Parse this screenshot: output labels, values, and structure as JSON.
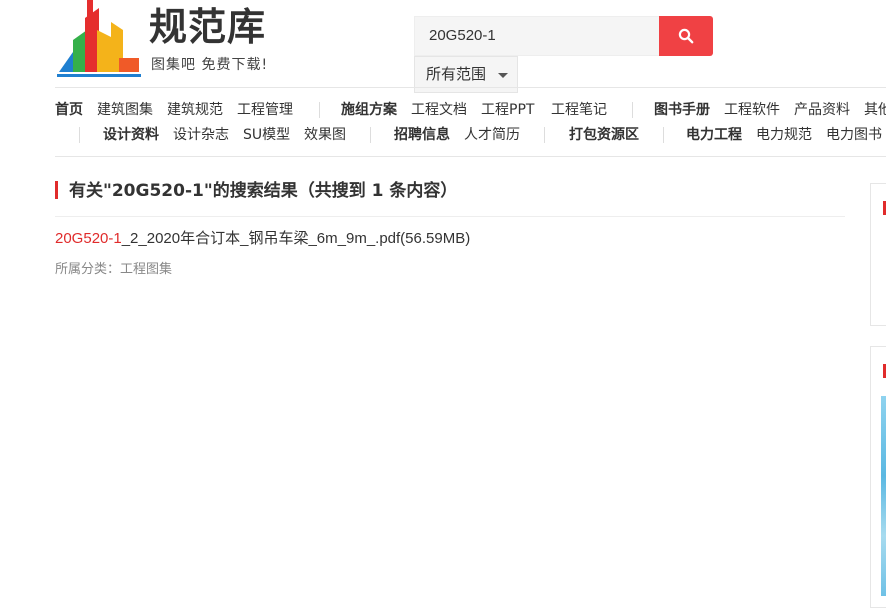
{
  "logo": {
    "title": "规范库",
    "slogan": "图集吧 免费下载!"
  },
  "search": {
    "query": "20G520-1",
    "scope": "所有范围"
  },
  "nav": {
    "row1": [
      "首页",
      "建筑图集",
      "建筑规范",
      "工程管理",
      "施组方案",
      "工程文档",
      "工程PPT",
      "工程笔记",
      "图书手册",
      "工程软件",
      "产品资料",
      "其他"
    ],
    "row2": [
      "设计资料",
      "设计杂志",
      "SU模型",
      "效果图",
      "招聘信息",
      "人才简历",
      "打包资源区",
      "电力工程",
      "电力规范",
      "电力图书"
    ]
  },
  "results": {
    "heading": "有关\"20G520-1\"的搜索结果（共搜到 1 条内容）",
    "items": [
      {
        "highlight": "20G520-1",
        "rest": "_2_2020年合订本_钢吊车梁_6m_9m_.pdf(56.59MB)",
        "category": "所属分类：工程图集"
      }
    ]
  },
  "colors": {
    "accent_red": "#f04144",
    "highlight_red": "#e02b2b",
    "text": "#333333",
    "muted": "#888888"
  },
  "icons": {
    "search_button": "search-icon",
    "scope_dropdown": "caret-down-icon"
  }
}
